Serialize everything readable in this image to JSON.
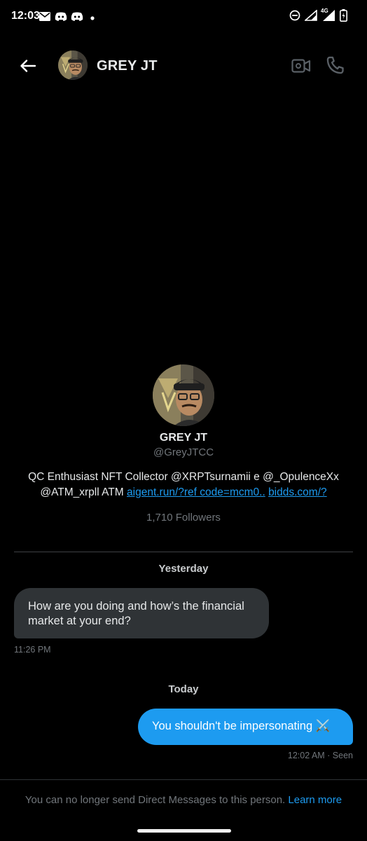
{
  "status_bar": {
    "time": "12:03",
    "network": "4G",
    "icons": [
      "mail-icon",
      "discord-icon",
      "discord-icon",
      "dot-icon",
      "dnd-icon",
      "wifi-icon",
      "signal-icon",
      "battery-icon"
    ]
  },
  "header": {
    "title": "GREY JT",
    "icons": [
      "back-arrow-icon",
      "video-call-icon",
      "phone-icon"
    ]
  },
  "profile": {
    "name": "GREY JT",
    "handle": "@GreyJTCC",
    "bio_text_1": "QC Enthusiast NFT Collector @XRPTsurnamii e @_OpulenceXx",
    "bio_text_2": "@ATM_xrpll ATM ",
    "bio_link_1": "aigent.run/?ref code=mcm0..",
    "bio_link_2": "bidds.com/?",
    "followers": "1,710 Followers"
  },
  "messages": {
    "yesterday_label": "Yesterday",
    "incoming": {
      "text": "How are you doing and how’s the financial market at your end?",
      "time": "11:26 PM"
    },
    "today_label": "Today",
    "outgoing": {
      "text": "You shouldn't be impersonating ⚔️",
      "time": "12:02 AM · Seen"
    }
  },
  "footer": {
    "notice": "You can no longer send Direct Messages to this person. ",
    "learn_more": "Learn more"
  },
  "colors": {
    "background": "#000000",
    "accent": "#1d9bf0",
    "incoming_bubble": "#2f3336",
    "muted": "#71767b"
  }
}
